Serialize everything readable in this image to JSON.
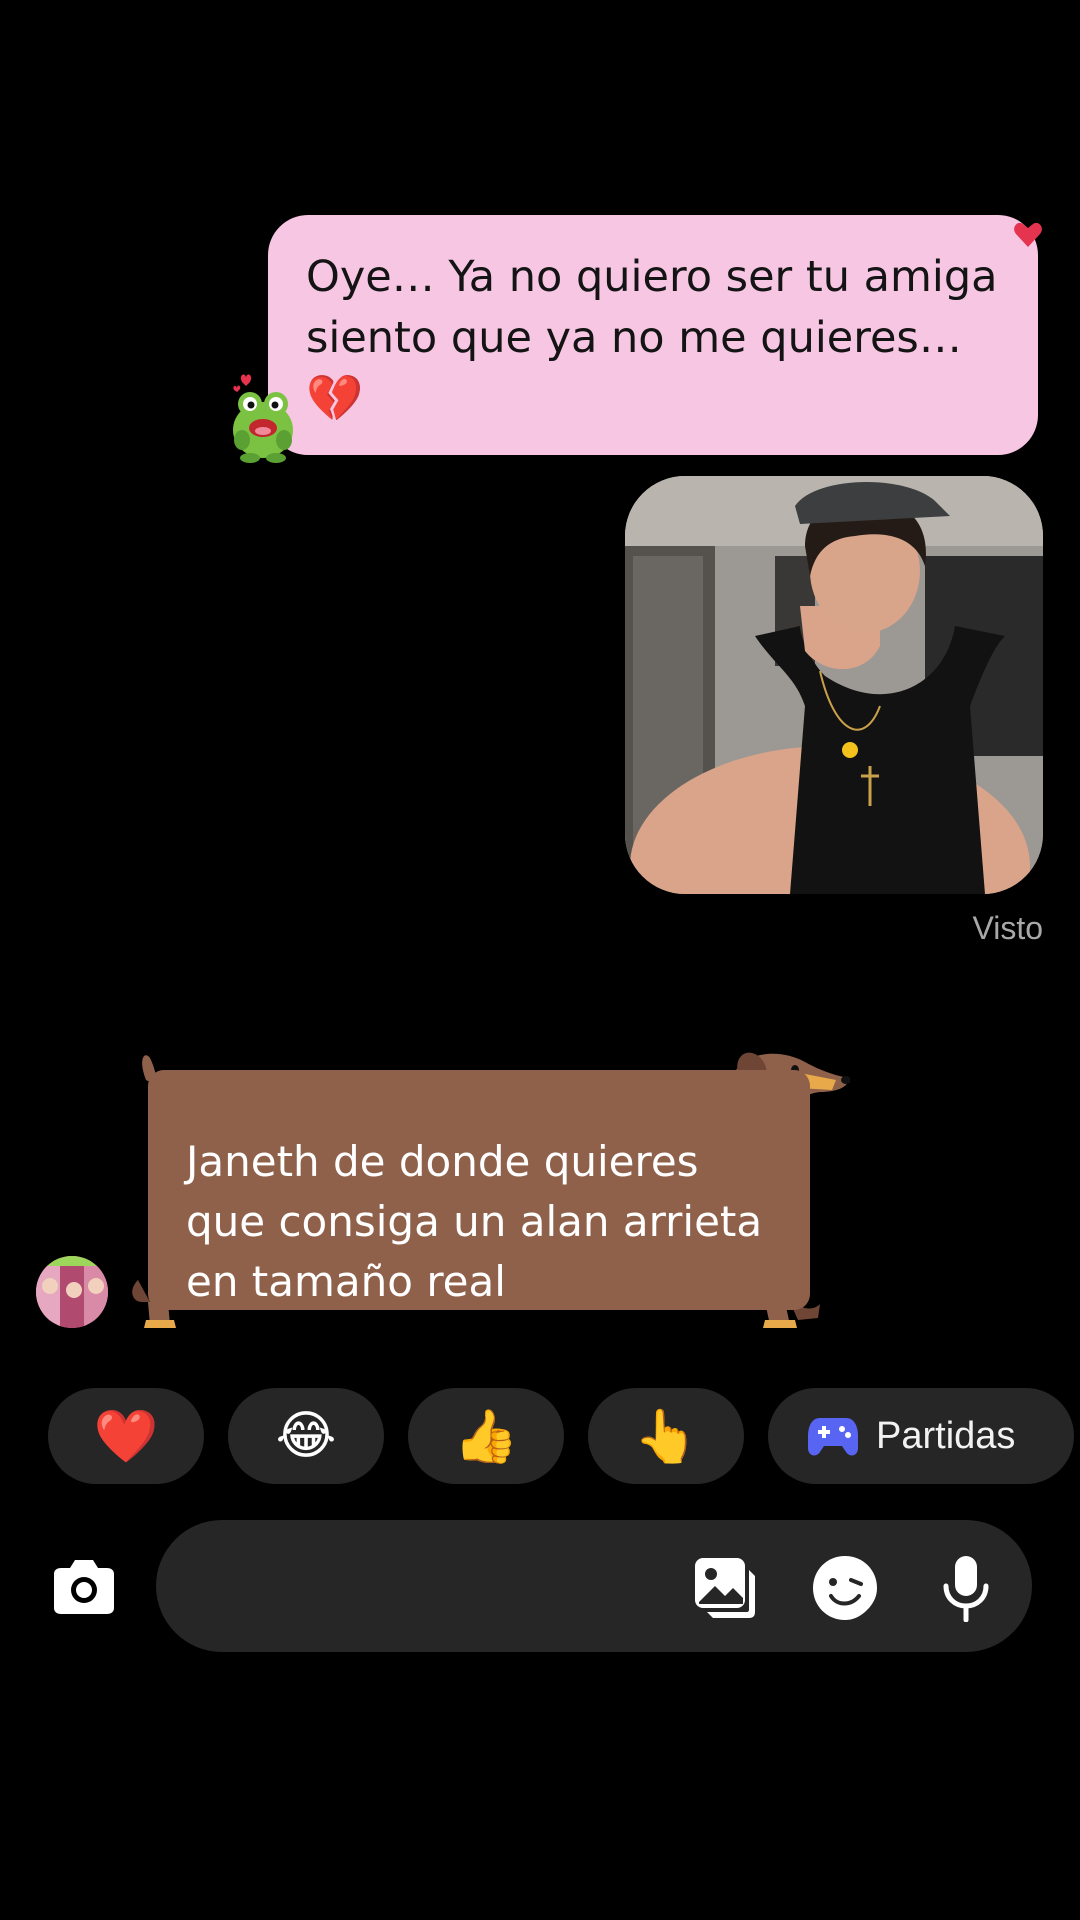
{
  "messages": {
    "outgoing_text": {
      "lines": [
        "Oye… Ya no quiero ser tu amiga",
        "siento que ya no me quieres…"
      ],
      "emoji": "💔",
      "bubble_color": "#f7c6e3"
    },
    "outgoing_image": {
      "seen_label": "Visto"
    },
    "incoming_text": {
      "lines": [
        "Janeth de donde quieres",
        "que consiga un alan arrieta",
        "en tamaño real"
      ],
      "bubble_color": "#8f614b"
    }
  },
  "quick_reactions": [
    {
      "emoji": "❤️",
      "icon": "heart-icon"
    },
    {
      "emoji": "😂",
      "icon": "laughing-emoji-icon"
    },
    {
      "emoji": "👍",
      "icon": "thumbs-up-icon"
    },
    {
      "emoji": "👆",
      "icon": "pointing-hand-icon"
    }
  ],
  "games_chip": {
    "label": "Partidas",
    "icon": "gamepad-icon",
    "icon_color": "#5865f2"
  },
  "composer": {
    "placeholder": "",
    "icons": [
      "camera-icon",
      "gallery-icon",
      "sticker-icon",
      "microphone-icon"
    ]
  }
}
